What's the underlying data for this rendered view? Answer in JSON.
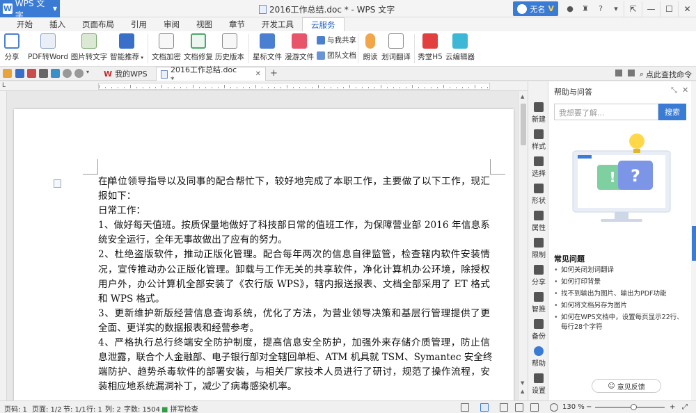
{
  "app": {
    "name": "WPS 文字",
    "window_title": "2016工作总结.doc * - WPS 文字",
    "user": "无名"
  },
  "menu_tabs": [
    "开始",
    "插入",
    "页面布局",
    "引用",
    "审阅",
    "视图",
    "章节",
    "开发工具",
    "云服务"
  ],
  "active_menu_tab": "云服务",
  "ribbon": {
    "share": "分享",
    "pdf_to_word": "PDF转Word",
    "image_to_text": "图片转文字",
    "smart_recommend": "智能推荐",
    "encrypt": "文档加密",
    "repair": "文档修复",
    "history": "历史版本",
    "star_file": "星标文件",
    "roam_file": "漫游文件",
    "share_with_me": "与我共享",
    "team_doc": "团队文档",
    "read_aloud": "朗读",
    "translate": "划词翻译",
    "xiuh5": "秀堂H5",
    "cloud_editor": "云编辑器"
  },
  "doc_tabs": [
    {
      "label": "我的WPS"
    },
    {
      "label": "2016工作总结.doc *"
    }
  ],
  "find_command": "点此查找命令",
  "document": {
    "lines": [
      {
        "text": "在单位领导指导以及同事的配合帮忙下，较好地完成了本职工作，主要做了以下工作，现汇",
        "justify": true
      },
      {
        "text": "报如下：",
        "justify": false
      },
      {
        "text": "日常工作：",
        "justify": false
      },
      {
        "text": "1、做好每天值班。按质保量地做好了科技部日常的值班工作，为保障营业部 2016 年信息系",
        "justify": true
      },
      {
        "text": "统安全运行，全年无事故做出了应有的努力。",
        "justify": false
      },
      {
        "text": "2、杜绝盗版软件，推动正版化管理。配合每年两次的信息自律监管，检查辖内软件安装情",
        "justify": true
      },
      {
        "text": "况，宣传推动办公正版化管理。卸载与工作无关的共享软件，净化计算机办公环境，除授权",
        "justify": true
      },
      {
        "text": "用户外，办公计算机全部安装了《农行版 WPS》，辖内报送报表、文档全部采用了 ET 格式",
        "justify": true
      },
      {
        "text": "和 WPS 格式。",
        "justify": false
      },
      {
        "text": "3、更新维护新版经营信息查询系统，优化了方法，为营业领导决策和基层行管理提供了更",
        "justify": true
      },
      {
        "text": "全面、更详实的数据报表和经营参考。",
        "justify": false
      },
      {
        "text": "4、严格执行总行终端安全防护制度，提高信息安全防护，加强外来存储介质管理，防止信",
        "justify": true
      },
      {
        "text": "息泄露，联合个人金融部、电子银行部对全辖回单柜、ATM 机具就 TSM、Symantec 安全终",
        "justify": true
      },
      {
        "text": "端防护、趋势杀毒软件的部署安装，与相关厂家技术人员进行了研讨，规范了操作流程，安",
        "justify": true
      },
      {
        "text": "装相应地系统漏洞补丁，减少了病毒感染机率。",
        "justify": false
      }
    ]
  },
  "toolstrip": [
    "新建",
    "样式",
    "选择",
    "形状",
    "属性",
    "限制",
    "分享",
    "智推",
    "备份",
    "帮助",
    "设置"
  ],
  "help_panel": {
    "title": "帮助与问答",
    "search_placeholder": "我想要了解...",
    "search_button": "搜索",
    "faq_title": "常见问题",
    "faq": [
      "如何关闭划词翻译",
      "如何打印背景",
      "找不到输出为图片、输出为PDF功能",
      "如何将文档另存为图片",
      "如何在WPS文档中，设置每页显示22行、每行28个字符"
    ],
    "feedback": "意见反馈"
  },
  "status": {
    "page_no": "页码: 1",
    "pages": "页面: 1/2",
    "section": "节: 1/1",
    "row": "行: 1",
    "col": "列: 2",
    "word_count": "字数: 1504",
    "spell_check": "拼写检查",
    "zoom": "130 %"
  },
  "colors": {
    "accent": "#3a7bd5"
  }
}
